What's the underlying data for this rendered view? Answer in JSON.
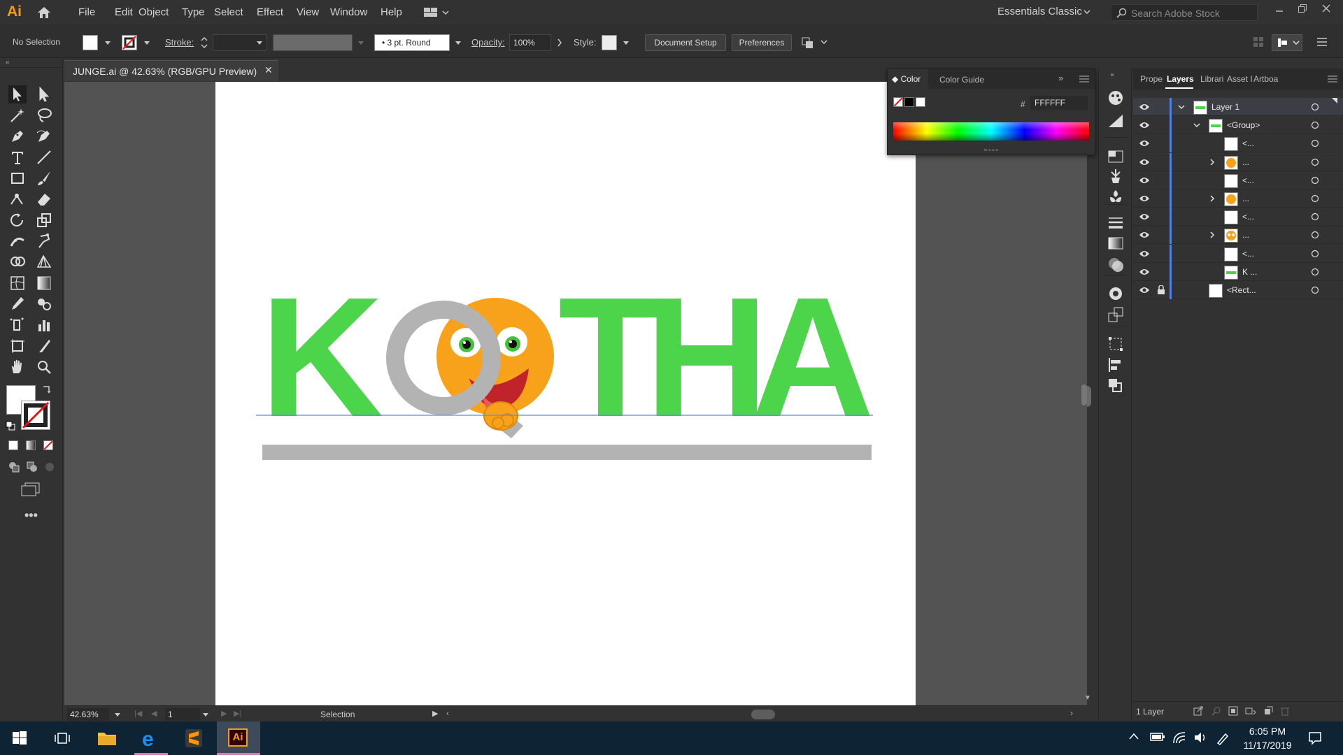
{
  "app": {
    "logo": "Ai",
    "menu": [
      "File",
      "Edit",
      "Object",
      "Type",
      "Select",
      "Effect",
      "View",
      "Window",
      "Help"
    ],
    "workspace": "Essentials Classic",
    "search_placeholder": "Search Adobe Stock"
  },
  "control_bar": {
    "selection_label": "No Selection",
    "stroke_label": "Stroke:",
    "brush_label": "3 pt. Round",
    "opacity_label": "Opacity:",
    "opacity_value": "100%",
    "style_label": "Style:",
    "document_setup": "Document Setup",
    "preferences": "Preferences"
  },
  "document": {
    "tab_title": "JUNGE.ai @ 42.63% (RGB/GPU Preview)",
    "close": "✕"
  },
  "artwork": {
    "letters_left": "K",
    "letters_right": "THA",
    "q_letter": "Q",
    "green": "#4cd44a",
    "grey": "#b3b3b3",
    "orange": "#f8a21b"
  },
  "status": {
    "zoom": "42.63%",
    "page": "1",
    "tool": "Selection"
  },
  "color_panel": {
    "tabs": [
      "Color",
      "Color Guide"
    ],
    "hex_label": "#",
    "hex_value": "FFFFFF"
  },
  "layers_panel": {
    "tabs": [
      "Prope",
      "Layers",
      "Librari",
      "Asset I",
      "Artboa"
    ],
    "rows": [
      {
        "name": "Layer 1",
        "level": 0,
        "expanded": true,
        "arrow": "v",
        "lock": false
      },
      {
        "name": "<Group>",
        "level": 1,
        "expanded": true,
        "arrow": "v",
        "lock": false
      },
      {
        "name": "<...",
        "level": 2,
        "arrow": "",
        "lock": false
      },
      {
        "name": "...",
        "level": 2,
        "arrow": ">",
        "lock": false
      },
      {
        "name": "<...",
        "level": 2,
        "arrow": "",
        "lock": false
      },
      {
        "name": "...",
        "level": 2,
        "arrow": ">",
        "lock": false
      },
      {
        "name": "<...",
        "level": 2,
        "arrow": "",
        "lock": false
      },
      {
        "name": "...",
        "level": 2,
        "arrow": ">",
        "lock": false
      },
      {
        "name": "<...",
        "level": 2,
        "arrow": "",
        "lock": false
      },
      {
        "name": "K ...",
        "level": 2,
        "arrow": "",
        "lock": false
      },
      {
        "name": "<Rect...",
        "level": 1,
        "arrow": "",
        "lock": true
      }
    ],
    "footer": "1 Layer"
  },
  "taskbar": {
    "time": "6:05 PM",
    "date": "11/17/2019",
    "ai_label": "Ai"
  }
}
